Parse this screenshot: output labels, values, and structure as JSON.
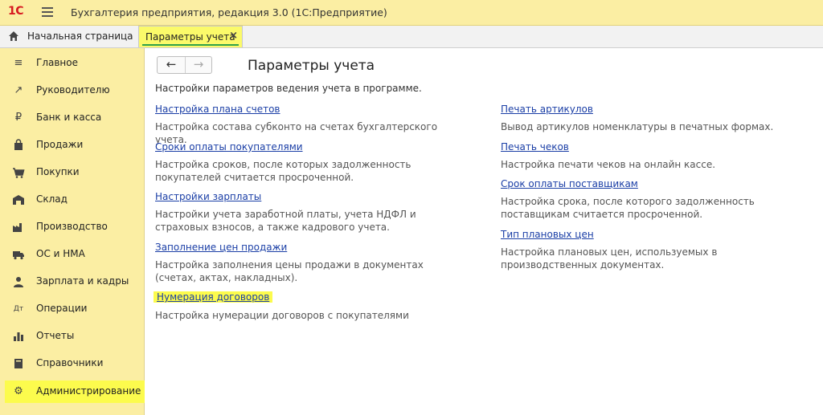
{
  "app": {
    "logo": "1С",
    "title": "Бухгалтерия предприятия, редакция 3.0  (1С:Предприятие)"
  },
  "tabs": {
    "home": "Начальная страница",
    "active": "Параметры учета",
    "close": "×"
  },
  "sidebar": {
    "items": [
      {
        "label": "Главное",
        "icon": "≡"
      },
      {
        "label": "Руководителю",
        "icon": "↗"
      },
      {
        "label": "Банк и касса",
        "icon": "₽"
      },
      {
        "label": "Продажи",
        "icon": "▲"
      },
      {
        "label": "Покупки",
        "icon": "▲"
      },
      {
        "label": "Склад",
        "icon": "▲"
      },
      {
        "label": "Производство",
        "icon": "▲"
      },
      {
        "label": "ОС и НМА",
        "icon": "▲"
      },
      {
        "label": "Зарплата и кадры",
        "icon": "▲"
      },
      {
        "label": "Операции",
        "icon": "Дт"
      },
      {
        "label": "Отчеты",
        "icon": "▲"
      },
      {
        "label": "Справочники",
        "icon": "▲"
      },
      {
        "label": "Администрирование",
        "icon": "⚙"
      }
    ]
  },
  "nav": {
    "back": "←",
    "forward": "→"
  },
  "page": {
    "title": "Параметры учета",
    "description": "Настройки параметров ведения учета в программе.",
    "left": [
      {
        "link": "Настройка плана счетов",
        "desc": "Настройка состава субконто на счетах бухгалтерского учета."
      },
      {
        "link": "Сроки оплаты покупателями",
        "desc": "Настройка сроков, после которых задолженность покупателей считается просроченной."
      },
      {
        "link": "Настройки зарплаты",
        "desc": "Настройки учета заработной платы, учета НДФЛ и страховых взносов, а также кадрового учета."
      },
      {
        "link": "Заполнение цен продажи",
        "desc": "Настройка заполнения цены продажи в документах (счетах, актах, накладных)."
      },
      {
        "link": "Нумерация договоров",
        "desc": "Настройка нумерации договоров с покупателями"
      }
    ],
    "right": [
      {
        "link": "Печать артикулов",
        "desc": "Вывод артикулов номенклатуры в печатных формах."
      },
      {
        "link": "Печать чеков",
        "desc": "Настройка печати чеков на онлайн кассе."
      },
      {
        "link": "Срок оплаты поставщикам",
        "desc": "Настройка срока, после которого задолженность поставщикам считается просроченной."
      },
      {
        "link": "Тип плановых цен",
        "desc": "Настройка плановых цен, используемых в производственных документах."
      }
    ]
  }
}
